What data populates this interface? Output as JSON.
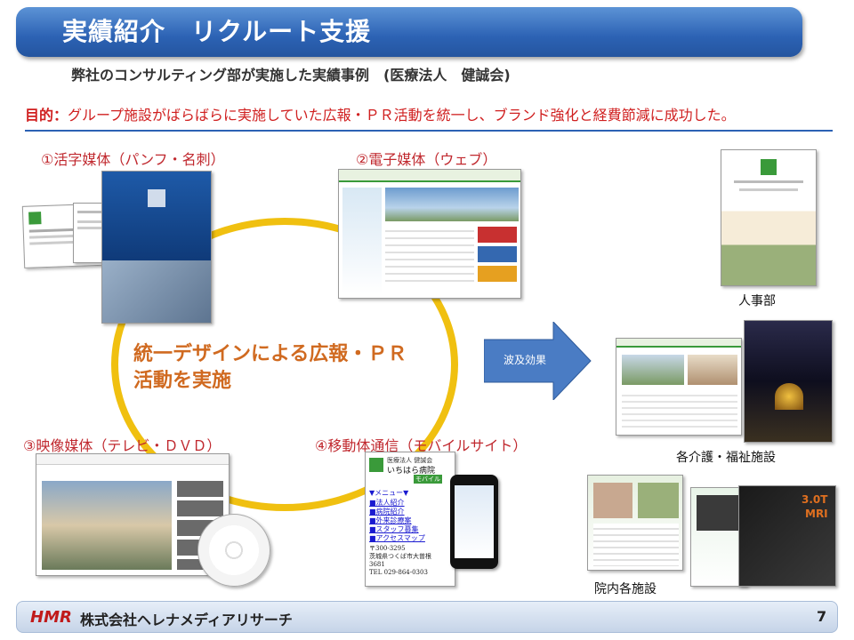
{
  "header": {
    "title": "実績紹介　リクルート支援",
    "subtitle": "弊社のコンサルティング部が実施した実績事例　(医療法人　健誠会)"
  },
  "purpose": {
    "label": "目的：",
    "text": "グループ施設がばらばらに実施していた広報・ＰＲ活動を統一し、ブランド強化と経費節減に成功した。"
  },
  "media": {
    "print": "①活字媒体（パンフ・名刺）",
    "web": "②電子媒体（ウェブ）",
    "video": "③映像媒体（テレビ・ＤＶＤ）",
    "mobile": "④移動体通信（モバイルサイト）"
  },
  "center": {
    "line1": "統一デザインによる広報・ＰＲ",
    "line2": "活動を実施"
  },
  "arrow_label": "波及効果",
  "mobile_screen": {
    "org": "医療法人 健誠会",
    "name": "いちはら病院",
    "sub": "モバイル",
    "menu_title": "▼メニュー▼",
    "menu": [
      "■法人紹介",
      "■病院紹介",
      "■外来診療案",
      "■スタッフ募集",
      "■アクセスマップ"
    ],
    "zip": "〒300-3295",
    "addr1": "茨城県つくば市大曽根",
    "addr2": "3681",
    "tel": "TEL 029-864-0303"
  },
  "results": {
    "hr": "人事部",
    "care": "各介護・福祉施設",
    "internal": "院内各施設"
  },
  "footer": {
    "logo": "HMR",
    "company": "株式会社ヘレナメディアリサーチ",
    "page": "7"
  },
  "colors": {
    "title_blue": "#2c62b4",
    "accent_red": "#d02020",
    "ring_yellow": "#f0c010",
    "arrow_blue": "#4a7cc4",
    "center_orange": "#d06a20"
  }
}
